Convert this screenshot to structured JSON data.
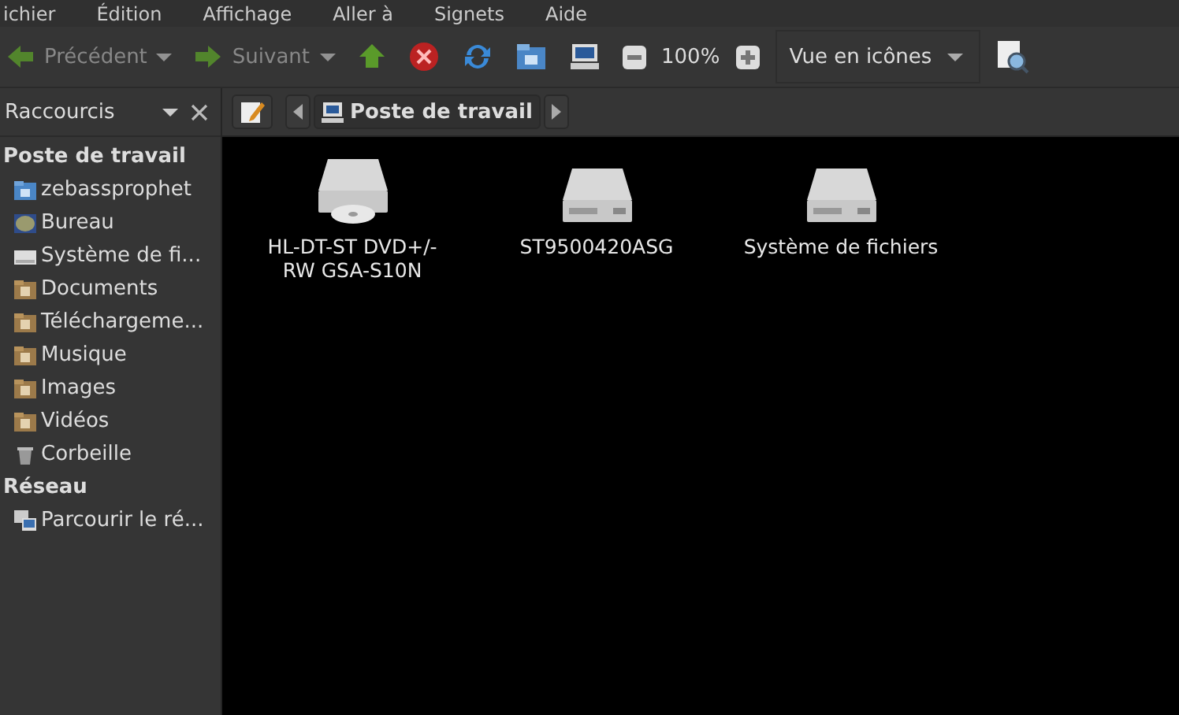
{
  "menu": [
    {
      "label": "ichier"
    },
    {
      "label": "Édition"
    },
    {
      "label": "Affichage"
    },
    {
      "label": "Aller à"
    },
    {
      "label": "Signets"
    },
    {
      "label": "Aide"
    }
  ],
  "toolbar": {
    "back": {
      "label": "Précédent",
      "disabled": true
    },
    "forward": {
      "label": "Suivant",
      "disabled": true
    },
    "zoom": "100%",
    "view_mode": "Vue en icônes"
  },
  "side_pane": {
    "title": "Raccourcis",
    "sections": [
      {
        "heading": "Poste de travail",
        "items": [
          {
            "label": "zebassprophet",
            "kind": "home"
          },
          {
            "label": "Bureau",
            "kind": "desktop"
          },
          {
            "label": "Système de fi...",
            "kind": "drive"
          },
          {
            "label": "Documents",
            "kind": "folder"
          },
          {
            "label": "Téléchargeme...",
            "kind": "folder"
          },
          {
            "label": "Musique",
            "kind": "folder"
          },
          {
            "label": "Images",
            "kind": "folder"
          },
          {
            "label": "Vidéos",
            "kind": "folder"
          },
          {
            "label": "Corbeille",
            "kind": "trash"
          }
        ]
      },
      {
        "heading": "Réseau",
        "items": [
          {
            "label": "Parcourir le ré...",
            "kind": "network"
          }
        ]
      }
    ]
  },
  "location": {
    "crumbs": [
      {
        "label": "Poste de travail",
        "selected": true
      }
    ]
  },
  "items": [
    {
      "label": "HL-DT-ST DVD+/- RW GSA-S10N",
      "kind": "optical"
    },
    {
      "label": "ST9500420ASG",
      "kind": "disk"
    },
    {
      "label": "Système de fichiers",
      "kind": "disk"
    }
  ]
}
